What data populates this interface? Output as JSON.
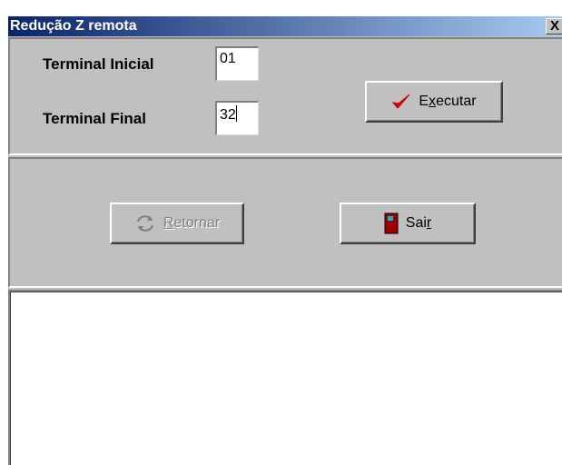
{
  "window": {
    "title": "Redução Z remota",
    "close_label": "X"
  },
  "form": {
    "terminal_inicial_label": "Terminal Inicial",
    "terminal_inicial_value": "01",
    "terminal_final_label": "Terminal Final",
    "terminal_final_value": "32"
  },
  "buttons": {
    "executar": {
      "pre": "E",
      "mnemonic": "x",
      "post": "ecutar",
      "icon": "checkmark-icon",
      "icon_color": "#e00000"
    },
    "retornar": {
      "pre": "",
      "mnemonic": "R",
      "post": "etornar",
      "icon": "refresh-icon",
      "disabled": true
    },
    "sair": {
      "pre": "Sai",
      "mnemonic": "r",
      "post": "",
      "icon": "door-exit-icon",
      "icon_color": "#a00000"
    }
  },
  "output": {
    "text": ""
  },
  "colors": {
    "titlebar_start": "#0a246a",
    "titlebar_end": "#a6caf0",
    "face": "#c0c0c0"
  }
}
